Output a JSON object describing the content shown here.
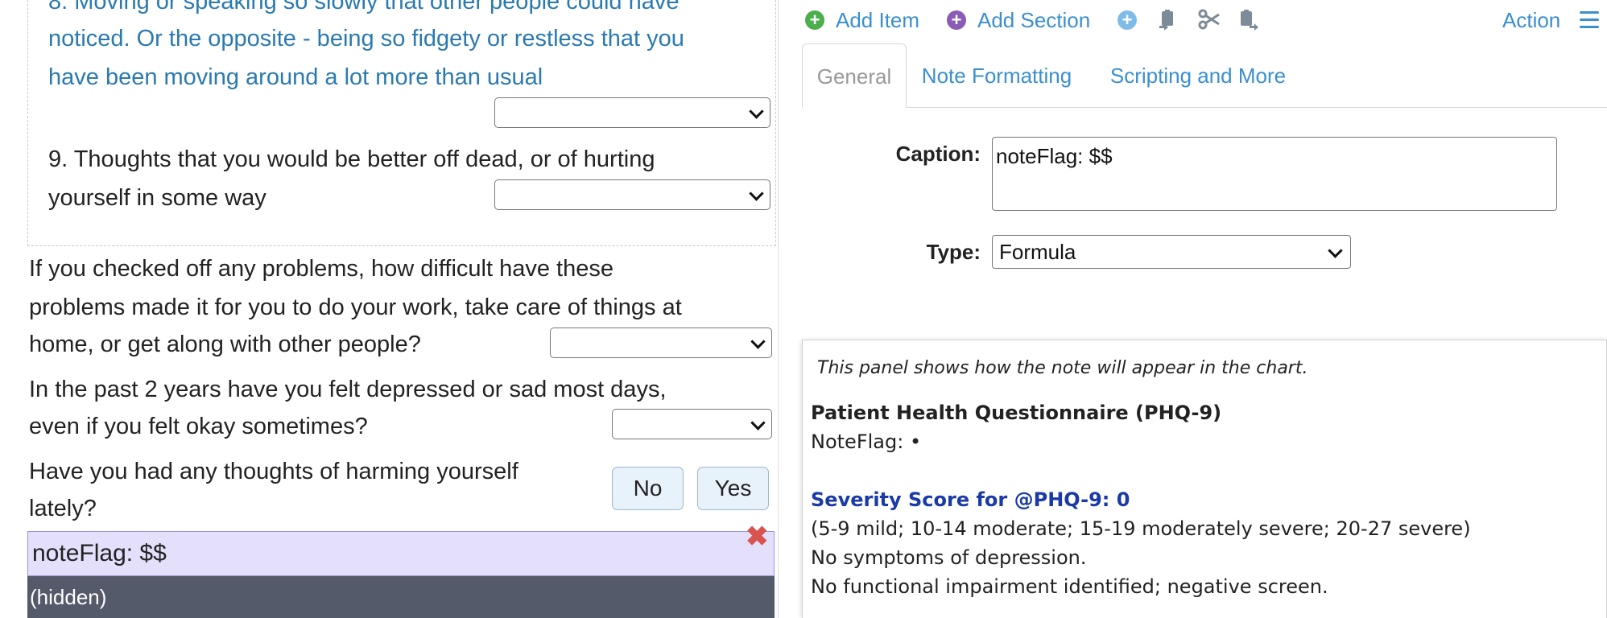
{
  "form": {
    "q8": {
      "lines": [
        "8. Moving or speaking so slowly that other people could have",
        "noticed. Or the opposite - being so fidgety or restless that you",
        "have been moving around a lot more than usual"
      ],
      "value": ""
    },
    "q9": {
      "lines": [
        "9. Thoughts that you would be better off dead, or of hurting",
        "yourself in some way"
      ],
      "value": ""
    },
    "difficulty": {
      "lines": [
        "If you checked off any problems, how difficult have these",
        "problems made it for you to do your work, take care of things at",
        "home, or get along with other people?"
      ],
      "value": ""
    },
    "past2years": {
      "lines": [
        "In the past 2 years have you felt depressed or sad most days,",
        "even if you felt okay sometimes?"
      ],
      "value": ""
    },
    "harming": {
      "lines": [
        "Have you had any thoughts of harming yourself",
        "lately?"
      ],
      "no_label": "No",
      "yes_label": "Yes"
    },
    "note_flag_text": "noteFlag: $$",
    "remove_glyph": "✖",
    "hidden_label": "(hidden)"
  },
  "toolbar": {
    "add_item": "Add Item",
    "add_section": "Add Section",
    "action": "Action",
    "colors": {
      "add_item": "#4cae4c",
      "add_section": "#8a5cb5",
      "add_other": "#7fbde8"
    }
  },
  "tabs": [
    {
      "label": "General",
      "active": true
    },
    {
      "label": "Note Formatting",
      "active": false
    },
    {
      "label": "Scripting and More",
      "active": false
    }
  ],
  "general": {
    "caption_label": "Caption:",
    "caption_value": "noteFlag: $$",
    "type_label": "Type:",
    "type_value": "Formula"
  },
  "preview": {
    "hint": "This panel shows how the note will appear in the chart.",
    "title": "Patient Health Questionnaire (PHQ-9)",
    "noteflag": "NoteFlag: •",
    "score_title": "Severity Score for @PHQ-9: 0",
    "ranges": "(5-9 mild; 10-14 moderate; 15-19 moderately severe; 20-27 severe)",
    "line_symptoms": "No symptoms of depression.",
    "line_impairment": "No functional impairment identified; negative screen."
  }
}
